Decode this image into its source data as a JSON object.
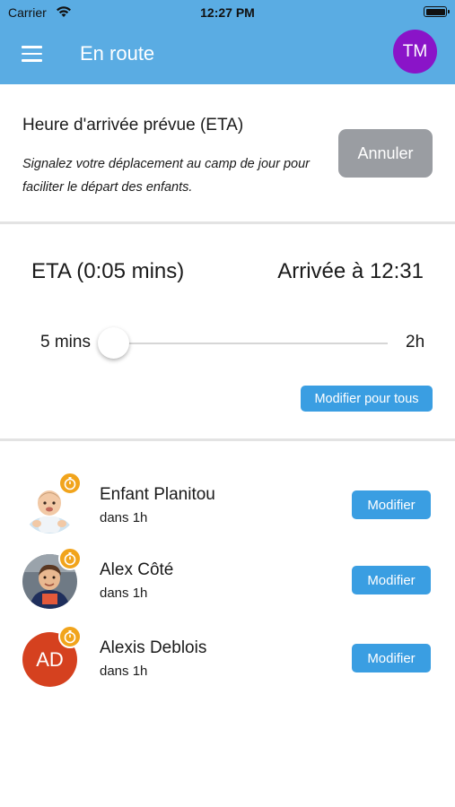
{
  "status_bar": {
    "carrier": "Carrier",
    "time": "12:27 PM"
  },
  "nav": {
    "title": "En route",
    "avatar_initials": "TM"
  },
  "eta_header": {
    "title": "Heure d'arrivée prévue (ETA)",
    "description": "Signalez votre déplacement au camp de jour pour faciliter le départ des enfants.",
    "cancel_label": "Annuler"
  },
  "eta": {
    "eta_label": "ETA (0:05 mins)",
    "arrival_label": "Arrivée à 12:31",
    "slider_min_label": "5 mins",
    "slider_max_label": "2h",
    "slider_value_fraction": 0.0,
    "modify_all_label": "Modifier pour tous"
  },
  "children": [
    {
      "name": "Enfant Planitou",
      "status": "dans 1h",
      "edit_label": "Modifier",
      "avatar": "baby-photo"
    },
    {
      "name": "Alex Côté",
      "status": "dans 1h",
      "edit_label": "Modifier",
      "avatar": "boy-photo"
    },
    {
      "name": "Alexis Deblois",
      "status": "dans 1h",
      "edit_label": "Modifier",
      "avatar_initials": "AD",
      "avatar_color": "#d5411f"
    }
  ],
  "colors": {
    "header": "#5aace3",
    "primary_button": "#3a9ee2",
    "cancel_button": "#9a9da2",
    "timer_badge": "#f1a41c",
    "avatar_tm": "#8a14c8"
  }
}
